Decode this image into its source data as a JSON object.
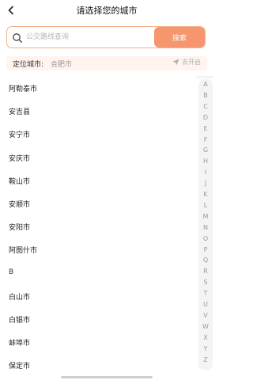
{
  "header": {
    "title": "请选择您的城市"
  },
  "search": {
    "placeholder": "公交路线查询",
    "button_label": "搜索"
  },
  "location": {
    "label": "定位城市:",
    "city": "合肥市",
    "action_label": "去开启"
  },
  "list": {
    "rows": [
      {
        "type": "city",
        "text": "阿勒泰市"
      },
      {
        "type": "city",
        "text": "安吉县"
      },
      {
        "type": "city",
        "text": "安宁市"
      },
      {
        "type": "city",
        "text": "安庆市"
      },
      {
        "type": "city",
        "text": "鞍山市"
      },
      {
        "type": "city",
        "text": "安顺市"
      },
      {
        "type": "city",
        "text": "安阳市"
      },
      {
        "type": "city",
        "text": "阿图什市"
      },
      {
        "type": "header",
        "text": "B"
      },
      {
        "type": "city",
        "text": "白山市"
      },
      {
        "type": "city",
        "text": "白银市"
      },
      {
        "type": "city",
        "text": "蚌埠市"
      },
      {
        "type": "city",
        "text": "保定市"
      }
    ]
  },
  "index_bar": {
    "letters": [
      "A",
      "B",
      "C",
      "D",
      "E",
      "F",
      "G",
      "H",
      "I",
      "J",
      "K",
      "L",
      "M",
      "N",
      "O",
      "P",
      "Q",
      "R",
      "S",
      "T",
      "U",
      "V",
      "W",
      "X",
      "Y",
      "Z"
    ]
  },
  "colors": {
    "accent": "#f5966e",
    "accent_border": "#f3b28c",
    "location_bg": "#fff4ee"
  }
}
